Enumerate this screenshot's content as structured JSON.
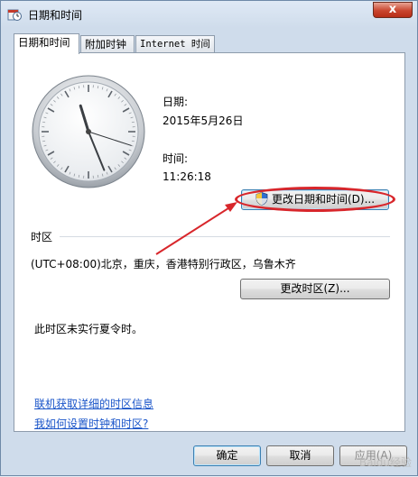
{
  "window": {
    "title": "日期和时间",
    "close_label": "x"
  },
  "tabs": [
    {
      "label": "日期和时间"
    },
    {
      "label": "附加时钟"
    },
    {
      "label": "Internet 时间"
    }
  ],
  "date": {
    "label": "日期:",
    "value": "2015年5月26日"
  },
  "time": {
    "label": "时间:",
    "value": "11:26:18"
  },
  "clock": {
    "hour": 11,
    "minute": 26,
    "second": 18
  },
  "change_datetime_button": "更改日期和时间(D)...",
  "timezone": {
    "section_label": "时区",
    "value": "(UTC+08:00)北京，重庆，香港特别行政区，乌鲁木齐",
    "change_button": "更改时区(Z)...",
    "dst_note": "此时区未实行夏令时。"
  },
  "links": {
    "online_info": "联机获取详细的时区信息",
    "how_to": "我如何设置时钟和时区?"
  },
  "footer": {
    "ok": "确定",
    "cancel": "取消",
    "apply": "应用(A)"
  },
  "watermark": "Baidu经验",
  "colors": {
    "annotation": "#d8262b",
    "link": "#1a55c9"
  }
}
